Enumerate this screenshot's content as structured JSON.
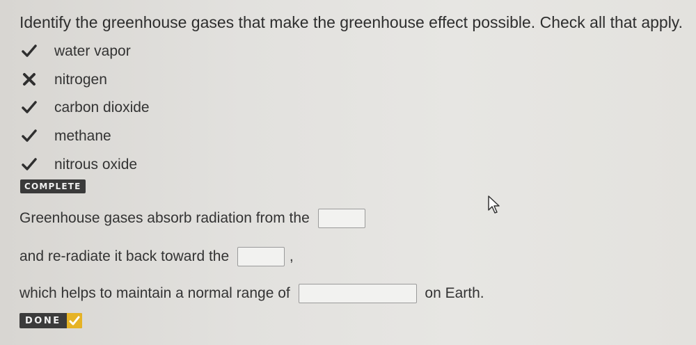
{
  "question": "Identify the greenhouse gases that make the greenhouse effect possible. Check all that apply.",
  "options": [
    {
      "label": "water vapor",
      "mark": "check-icon"
    },
    {
      "label": "nitrogen",
      "mark": "x-icon"
    },
    {
      "label": "carbon dioxide",
      "mark": "check-icon"
    },
    {
      "label": "methane",
      "mark": "check-icon"
    },
    {
      "label": "nitrous oxide",
      "mark": "check-icon"
    }
  ],
  "status_badge": "COMPLETE",
  "fill_in": {
    "line1": {
      "text": "Greenhouse gases absorb radiation from the",
      "blank_value": ""
    },
    "line2": {
      "text": "and re-radiate it back toward the",
      "blank_value": "",
      "after": ","
    },
    "line3": {
      "text": "which helps to maintain a normal range of",
      "blank_value": "",
      "after": "on Earth."
    }
  },
  "done_button": {
    "label": "DONE",
    "icon": "check-icon"
  },
  "colors": {
    "check": "#2f2f2f",
    "done_bg": "#3b3b3b",
    "done_check_bg": "#e6b325"
  }
}
